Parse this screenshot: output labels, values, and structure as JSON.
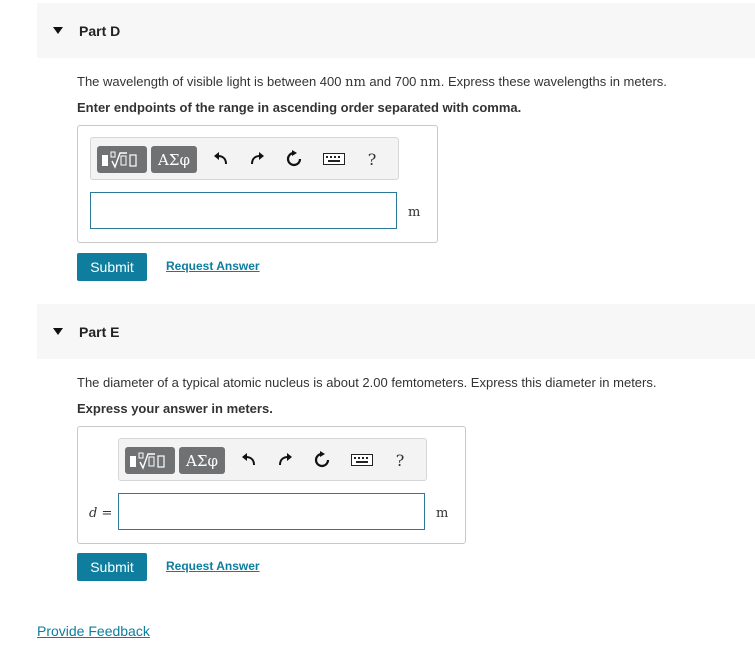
{
  "part_d": {
    "title": "Part D",
    "question_prefix": "The wavelength of visible light is between 400 ",
    "unit_nm_1": "nm",
    "question_mid": " and 700 ",
    "unit_nm_2": "nm",
    "question_suffix": ". Express these wavelengths in meters.",
    "instruction": "Enter endpoints of the range in ascending order separated with comma.",
    "answer_value": "",
    "unit": "m",
    "submit_label": "Submit",
    "request_label": "Request Answer"
  },
  "part_e": {
    "title": "Part E",
    "question": "The diameter of a typical atomic nucleus is about 2.00 femtometers. Express this diameter in meters.",
    "instruction": "Express your answer in meters.",
    "variable": "d",
    "equals": " =",
    "answer_value": "",
    "unit": "m",
    "submit_label": "Submit",
    "request_label": "Request Answer"
  },
  "toolbar": {
    "symbols_label": "ΑΣφ",
    "help_label": "?",
    "icons": [
      "templates-icon",
      "symbols-icon",
      "undo-icon",
      "redo-icon",
      "reset-icon",
      "keyboard-icon",
      "help-icon"
    ]
  },
  "footer": {
    "feedback_label": "Provide Feedback"
  },
  "colors": {
    "accent": "#0e7d9e",
    "header_bg": "#f7f7f7",
    "tool_btn": "#6f7173"
  }
}
